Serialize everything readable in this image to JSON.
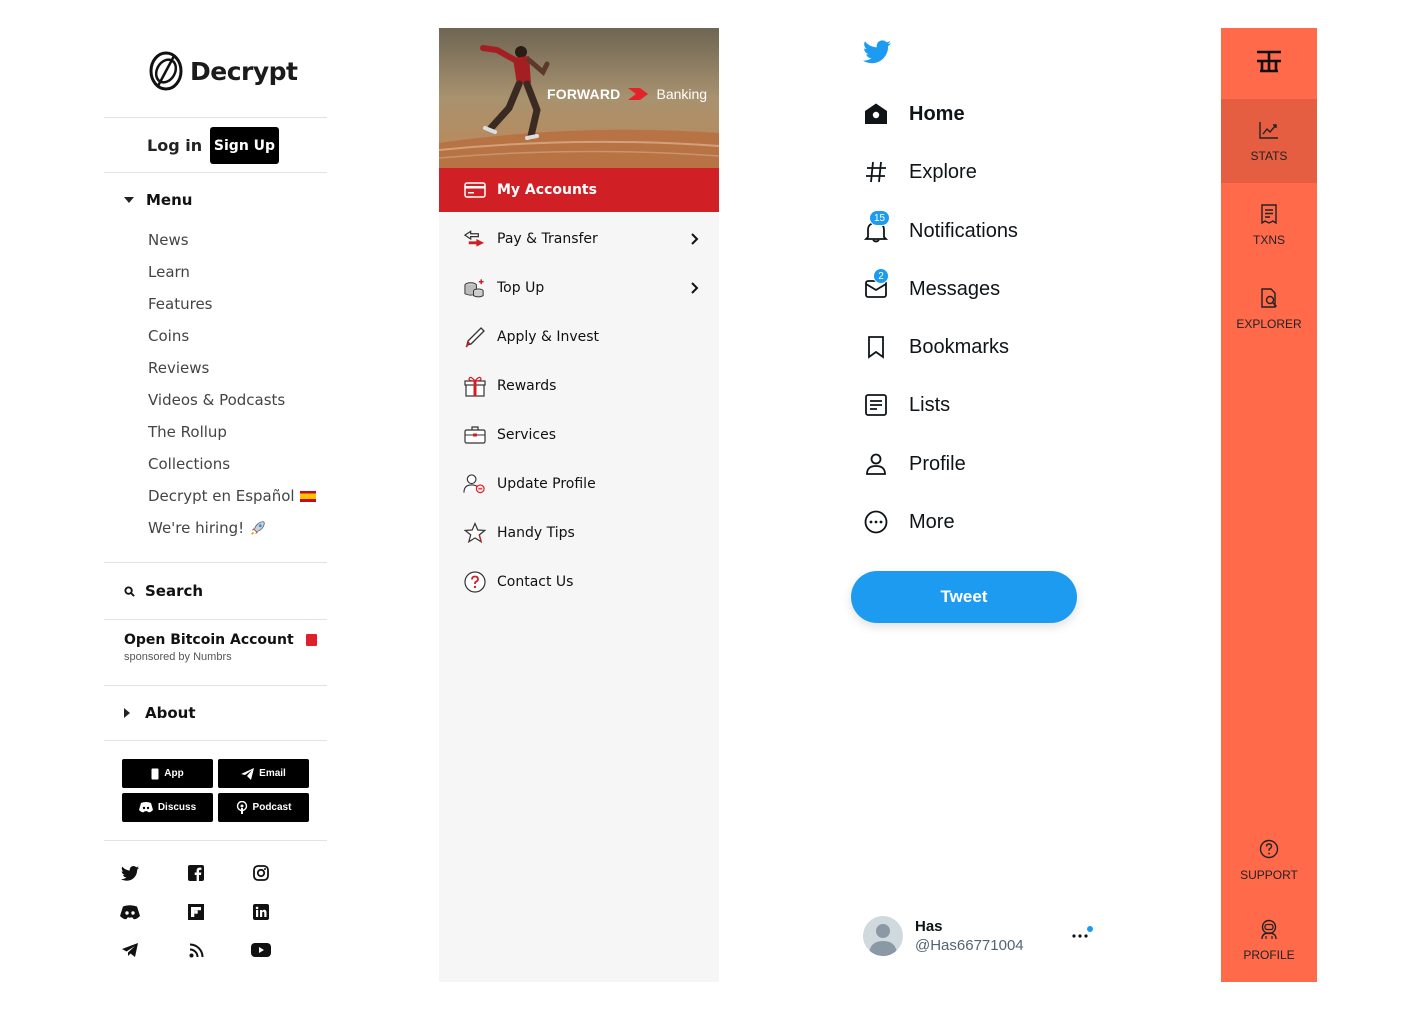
{
  "decrypt": {
    "brand": "Decrypt",
    "login": "Log in",
    "signup": "Sign Up",
    "menu_label": "Menu",
    "menu_items": [
      "News",
      "Learn",
      "Features",
      "Coins",
      "Reviews",
      "Videos & Podcasts",
      "The Rollup",
      "Collections",
      "Decrypt en Español",
      "We're hiring!"
    ],
    "search": "Search",
    "sponsor_title": "Open Bitcoin Account",
    "sponsor_sub": "sponsored by Numbrs",
    "about": "About",
    "buttons": [
      "App",
      "Email",
      "Discuss",
      "Podcast"
    ],
    "social_icons": [
      "twitter-icon",
      "facebook-icon",
      "instagram-icon",
      "discord-icon",
      "flipboard-icon",
      "linkedin-icon",
      "telegram-icon",
      "rss-icon",
      "youtube-icon"
    ]
  },
  "forward": {
    "hero_brand": "FORWARD",
    "hero_sub": "Banking",
    "active": "My Accounts",
    "items": [
      "Pay & Transfer",
      "Top Up",
      "Apply & Invest",
      "Rewards",
      "Services",
      "Update Profile",
      "Handy Tips",
      "Contact Us"
    ],
    "accent": "#d01f25"
  },
  "twitter": {
    "nav": [
      "Home",
      "Explore",
      "Notifications",
      "Messages",
      "Bookmarks",
      "Lists",
      "Profile",
      "More"
    ],
    "notifications_badge": "15",
    "messages_badge": "2",
    "tweet": "Tweet",
    "user_name": "Has",
    "user_handle": "@Has66771004",
    "accent": "#1d9bf0"
  },
  "explorer": {
    "items": [
      "STATS",
      "TXNS",
      "EXPLORER",
      "SUPPORT",
      "PROFILE"
    ],
    "accent": "#ff6a4a"
  }
}
